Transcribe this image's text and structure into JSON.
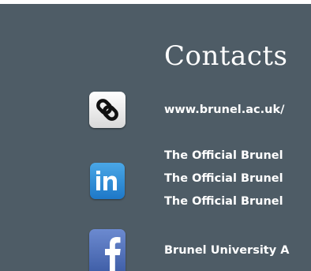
{
  "header": {
    "title": "Contacts"
  },
  "website": {
    "icon": "link-chain-icon",
    "url": "www.brunel.ac.uk/"
  },
  "linkedin": {
    "icon": "linkedin-icon",
    "links": [
      "The Official Brunel",
      "The Official Brunel",
      "The Official Brunel"
    ]
  },
  "facebook": {
    "icon": "facebook-icon",
    "links": [
      "Brunel University A"
    ]
  },
  "colors": {
    "panel_background": "#4e5c66",
    "text": "#ffffff",
    "linkedin_blue": "#2a86d4",
    "facebook_blue": "#3b5aa3"
  }
}
